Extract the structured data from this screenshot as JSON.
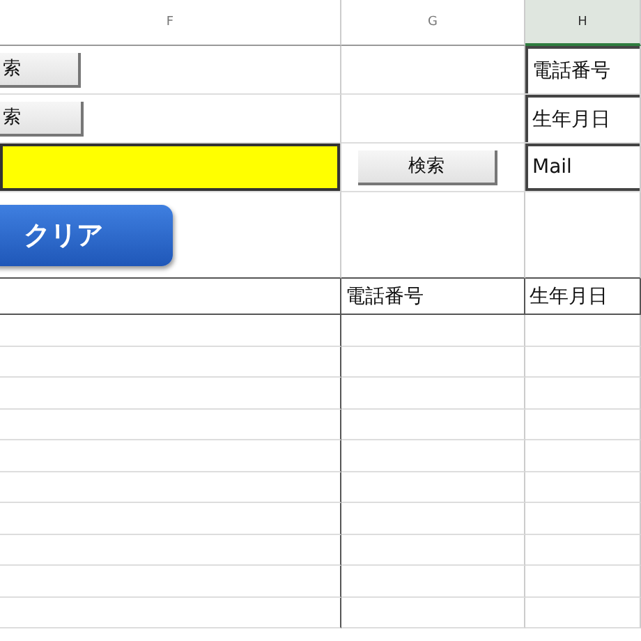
{
  "column_headers": [
    {
      "label": "F",
      "selected": false
    },
    {
      "label": "G",
      "selected": false
    },
    {
      "label": "H",
      "selected": true
    }
  ],
  "left_buttons": [
    {
      "label": "索"
    },
    {
      "label": "索"
    }
  ],
  "search_field": {
    "highlighted": true
  },
  "search_button": {
    "label": "検索"
  },
  "field_labels": [
    "電話番号",
    "生年月日",
    "Mail"
  ],
  "clear_button": {
    "label": "クリア"
  },
  "table": {
    "columns": [
      "電話番号",
      "生年月日"
    ]
  }
}
